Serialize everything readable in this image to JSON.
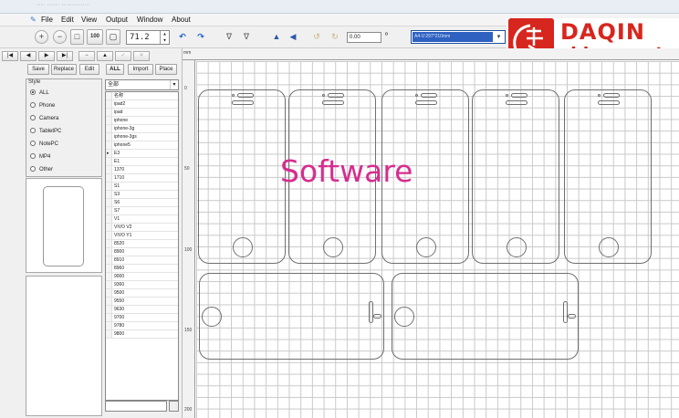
{
  "window": {
    "title": "···· ······ ·············"
  },
  "menu": [
    "File",
    "Edit",
    "View",
    "Output",
    "Window",
    "About"
  ],
  "toolbar": {
    "zoom_in": "+",
    "zoom_out": "−",
    "fit": "□",
    "actual_size": "100",
    "blank": "▢",
    "zoom_value": "71.2",
    "undo": "↶",
    "redo": "↷",
    "flip_h": "∇",
    "flip_v": "∇",
    "triangle_a": "▲",
    "triangle_b": "◀",
    "rotate_left": "↺",
    "rotate_right": "↻",
    "rotation_value": "0.00",
    "degree": "º",
    "device_value": "A4-V:297*210mm"
  },
  "logo": {
    "brand": "DAQIN",
    "domain": "chinee.net",
    "emblem_text": "大秦"
  },
  "watermark": "Software",
  "nav": [
    "|◀",
    "◀",
    "▶",
    "▶|",
    "−",
    "▲",
    "✓",
    "✕"
  ],
  "actions": [
    "Save",
    "Replace",
    "Edit",
    "ALL",
    "Import",
    "Place"
  ],
  "style_group": {
    "legend": "Style",
    "options": [
      {
        "label": "ALL",
        "selected": true
      },
      {
        "label": "Phone",
        "selected": false
      },
      {
        "label": "Camera",
        "selected": false
      },
      {
        "label": "TabletPC",
        "selected": false
      },
      {
        "label": "NotePC",
        "selected": false
      },
      {
        "label": "MP4",
        "selected": false
      },
      {
        "label": "Other",
        "selected": false
      }
    ]
  },
  "model_filter": {
    "value": "全部"
  },
  "models": [
    "名称",
    "ipad2",
    "ipad",
    "iphone",
    "iphone-3g",
    "iphone-3gs",
    "iphone5",
    "E3",
    "E1",
    "1370",
    "1710",
    "S1",
    "S3",
    "S6",
    "S7",
    "V1",
    "VIVO V2",
    "VIVO Y1",
    "8520",
    "8900",
    "8910",
    "8960",
    "9000",
    "9360",
    "9500",
    "9550",
    "9630",
    "9700",
    "9780",
    "9800"
  ],
  "selected_model_index": 7,
  "ruler": {
    "unit": "mm",
    "left_labels": [
      "0",
      "50",
      "100",
      "150",
      "200"
    ]
  }
}
